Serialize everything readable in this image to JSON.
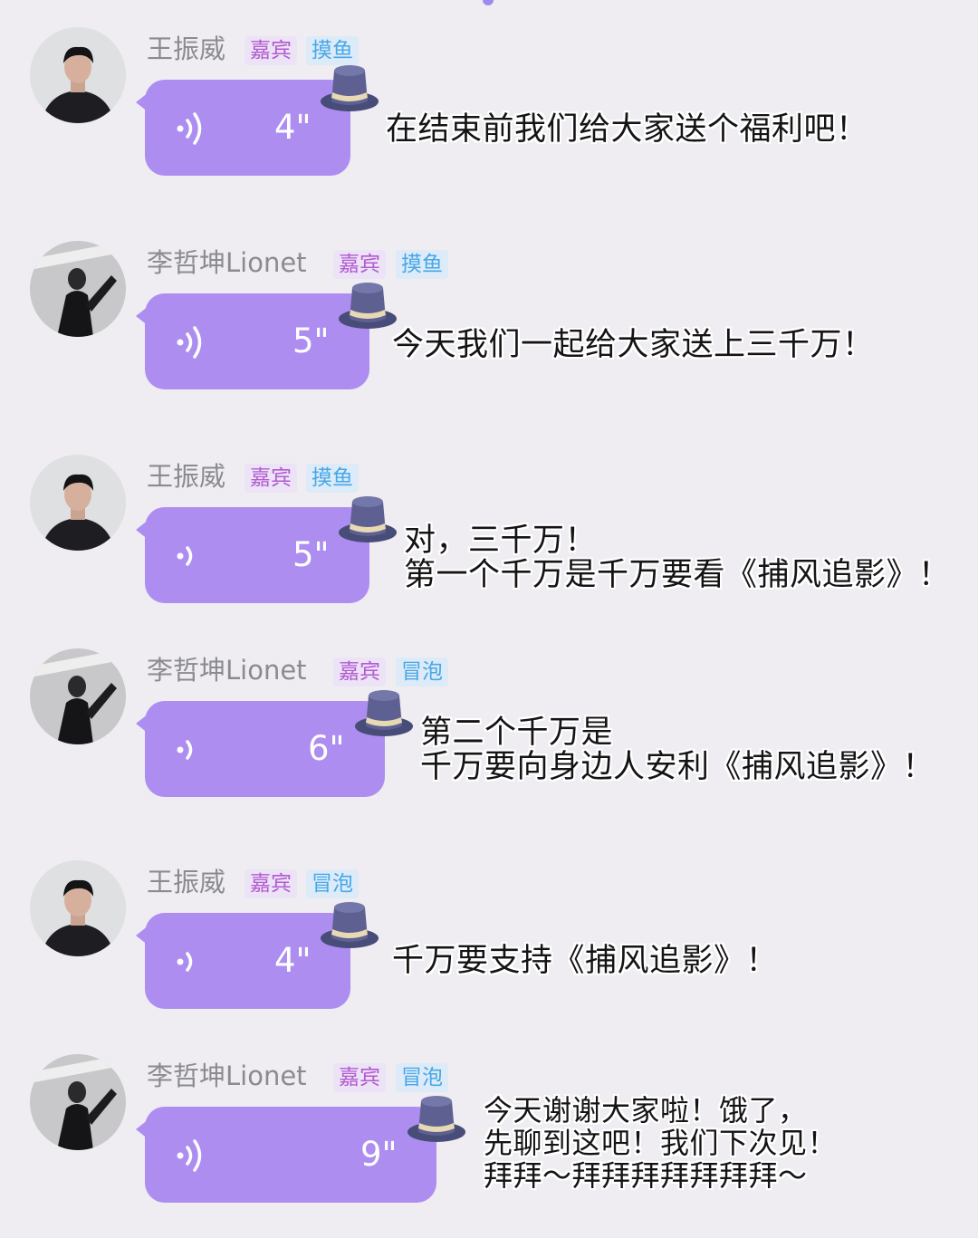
{
  "tags": {
    "guest": "嘉宾",
    "status_fish": "摸鱼",
    "status_bubble": "冒泡"
  },
  "colors": {
    "background": "#efedf2",
    "bubble": "#ad8ef0",
    "guest_tag": "#b25bd0",
    "status_tag": "#47a7e8"
  },
  "icons": {
    "voice": "sound-wave-icon",
    "decoration": "top-hat-icon"
  },
  "messages": [
    {
      "sender": "王振威",
      "tag": "嘉宾",
      "status": "摸鱼",
      "duration": "4\"",
      "caption_lines": [
        "在结束前我们给大家送个福利吧！"
      ]
    },
    {
      "sender": "李哲坤Lionet",
      "tag": "嘉宾",
      "status": "摸鱼",
      "duration": "5\"",
      "caption_lines": [
        "今天我们一起给大家送上三千万！"
      ]
    },
    {
      "sender": "王振威",
      "tag": "嘉宾",
      "status": "摸鱼",
      "duration": "5\"",
      "caption_lines": [
        "对，三千万！",
        "第一个千万是千万要看《捕风追影》！"
      ]
    },
    {
      "sender": "李哲坤Lionet",
      "tag": "嘉宾",
      "status": "冒泡",
      "duration": "6\"",
      "caption_lines": [
        "第二个千万是",
        "千万要向身边人安利《捕风追影》！"
      ]
    },
    {
      "sender": "王振威",
      "tag": "嘉宾",
      "status": "冒泡",
      "duration": "4\"",
      "caption_lines": [
        "千万要支持《捕风追影》！"
      ]
    },
    {
      "sender": "李哲坤Lionet",
      "tag": "嘉宾",
      "status": "冒泡",
      "duration": "9\"",
      "caption_lines": [
        "今天谢谢大家啦！饿了，",
        "先聊到这吧！我们下次见！",
        "拜拜～拜拜拜拜拜拜拜～"
      ]
    }
  ]
}
